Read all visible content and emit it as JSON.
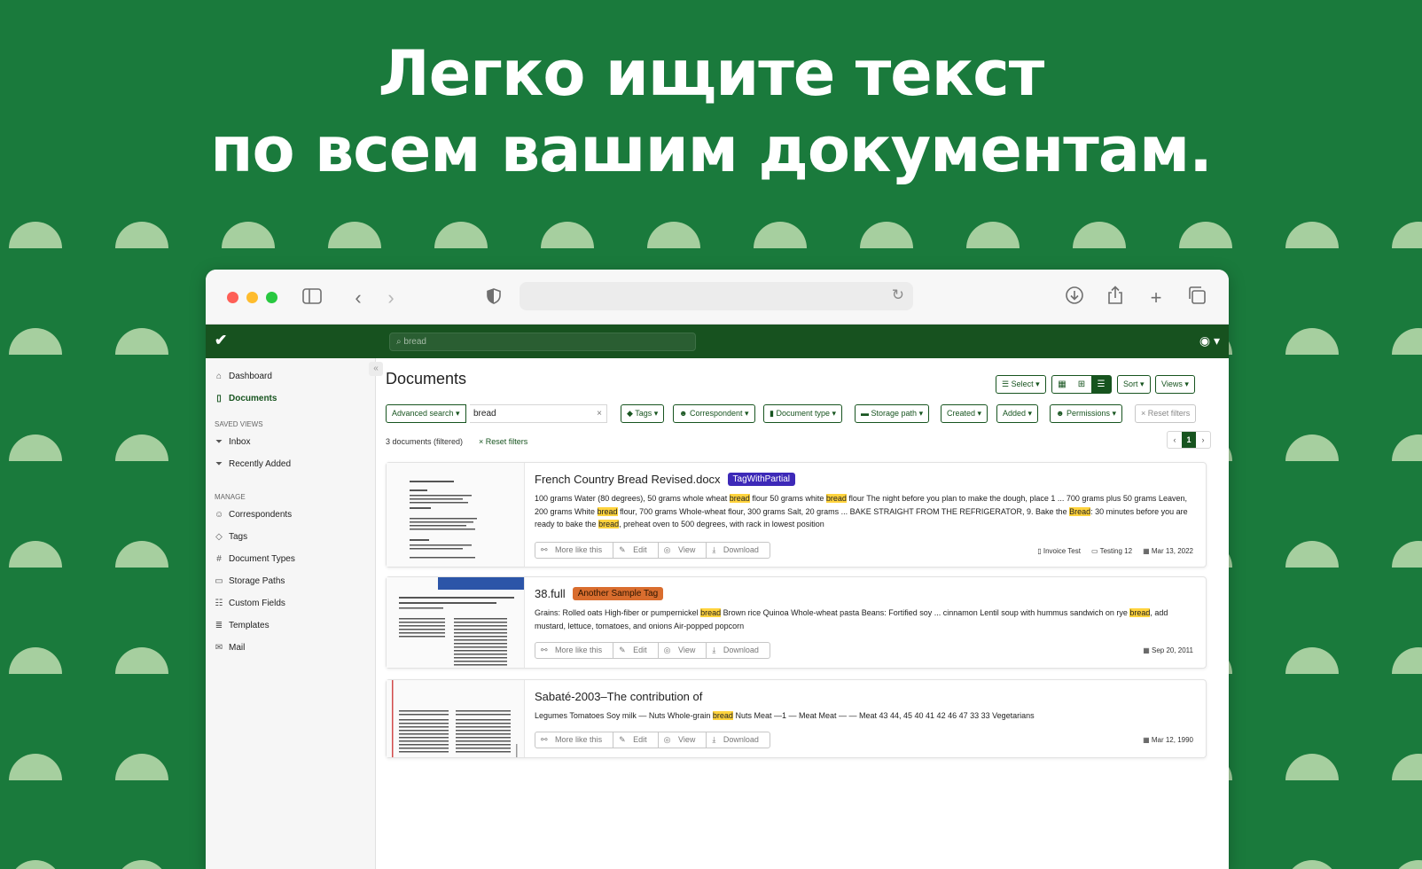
{
  "headline": {
    "line1": "Легко ищите текст",
    "line2": "по всем вашим документам."
  },
  "colors": {
    "background": "#1a7a3c",
    "dots": "#a6cf9f",
    "app_bar": "#17521f",
    "accent": "#17541f",
    "highlight": "#ffd33d"
  },
  "app": {
    "logo_icon": "check-icon",
    "global_search": "bread",
    "user_icon": "user-circle-icon"
  },
  "sidebar": {
    "items": [
      {
        "label": "Dashboard",
        "icon": "house-icon"
      },
      {
        "label": "Documents",
        "icon": "document-icon"
      }
    ],
    "saved_views_title": "SAVED VIEWS",
    "saved_views": [
      {
        "label": "Inbox",
        "icon": "funnel-icon"
      },
      {
        "label": "Recently Added",
        "icon": "funnel-icon"
      }
    ],
    "manage_title": "MANAGE",
    "manage": [
      {
        "label": "Correspondents",
        "icon": "person-icon"
      },
      {
        "label": "Tags",
        "icon": "tag-icon"
      },
      {
        "label": "Document Types",
        "icon": "hash-icon"
      },
      {
        "label": "Storage Paths",
        "icon": "folder-icon"
      },
      {
        "label": "Custom Fields",
        "icon": "form-icon"
      },
      {
        "label": "Templates",
        "icon": "file-text-icon"
      },
      {
        "label": "Mail",
        "icon": "envelope-icon"
      }
    ]
  },
  "toolbar": {
    "title": "Documents",
    "select": "Select",
    "sort": "Sort",
    "views": "Views"
  },
  "filters": {
    "advanced_search": "Advanced search",
    "query": "bread",
    "tags": "Tags",
    "correspondent": "Correspondent",
    "document_type": "Document type",
    "storage_path": "Storage path",
    "created": "Created",
    "added": "Added",
    "permissions": "Permissions",
    "reset": "Reset filters"
  },
  "results": {
    "count": "3 documents (filtered)",
    "reset": "Reset filters",
    "current_page": "1"
  },
  "actions": {
    "more": "More like this",
    "edit": "Edit",
    "view": "View",
    "download": "Download"
  },
  "documents": [
    {
      "title": "French Country Bread Revised.docx",
      "tag": "TagWithPartial",
      "tag_color": "#3d29b8",
      "snippet_parts": [
        {
          "t": "100 grams Water (80 degrees), 50 grams whole wheat "
        },
        {
          "t": "bread",
          "h": true
        },
        {
          "t": " flour 50 grams white "
        },
        {
          "t": "bread",
          "h": true
        },
        {
          "t": " flour The night before you plan to make the dough, place 1 ... 700 grams plus 50 grams Leaven, 200 grams White "
        },
        {
          "t": "bread",
          "h": true
        },
        {
          "t": " flour, 700 grams Whole-wheat flour, 300 grams Salt, 20 grams ... BAKE STRAIGHT FROM THE REFRIGERATOR, 9. Bake the "
        },
        {
          "t": "Bread",
          "h": true
        },
        {
          "t": ": 30 minutes before you are ready to bake the "
        },
        {
          "t": "bread",
          "h": true
        },
        {
          "t": ", preheat oven to 500 degrees, with rack in lowest position"
        }
      ],
      "meta": {
        "document_type": "Invoice Test",
        "storage_path": "Testing 12",
        "created": "Mar 13, 2022"
      }
    },
    {
      "title": "38.full",
      "tag": "Another Sample Tag",
      "tag_color": "#d96d2e",
      "snippet_parts": [
        {
          "t": "Grains: Rolled oats High-fiber or pumpernickel "
        },
        {
          "t": "bread",
          "h": true
        },
        {
          "t": " Brown rice Quinoa Whole-wheat pasta Beans: Fortified soy ... cinnamon Lentil soup with hummus sandwich on rye "
        },
        {
          "t": "bread",
          "h": true
        },
        {
          "t": ", add mustard, lettuce, tomatoes, and onions Air-popped popcorn"
        }
      ],
      "meta": {
        "created": "Sep 20, 2011"
      }
    },
    {
      "title": "Sabaté-2003–The contribution of",
      "tag": "",
      "snippet_parts": [
        {
          "t": "Legumes Tomatoes Soy milk — Nuts Whole-grain "
        },
        {
          "t": "bread",
          "h": true
        },
        {
          "t": " Nuts Meat —1 — Meat Meat — — Meat 43 44, 45 40 41 42 46 47 33 33 Vegetarians"
        }
      ],
      "meta": {
        "created": "Mar 12, 1990"
      }
    }
  ]
}
